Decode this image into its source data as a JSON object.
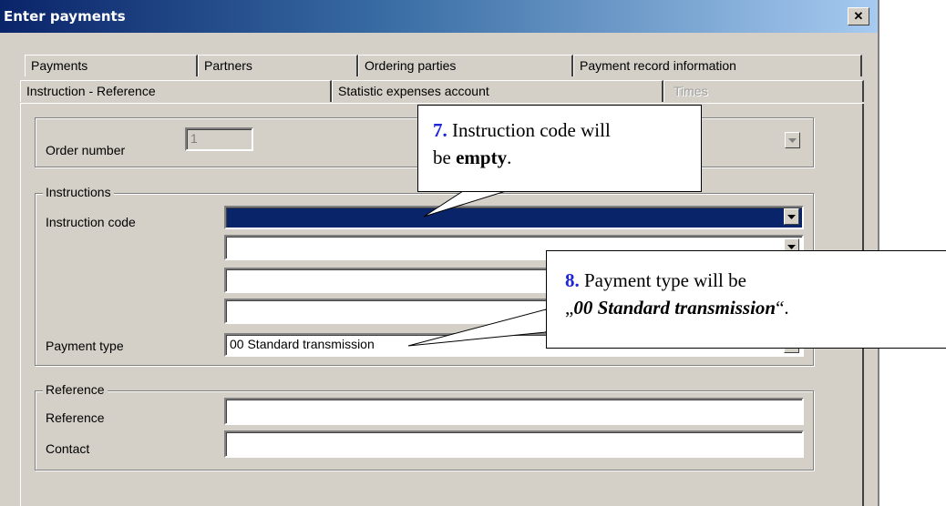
{
  "window": {
    "title": "Enter payments",
    "close_glyph": "✕"
  },
  "tabs_row1": [
    {
      "label": "Payments",
      "disabled": false
    },
    {
      "label": "Partners",
      "disabled": false
    },
    {
      "label": "Ordering parties",
      "disabled": false
    },
    {
      "label": "Payment record information",
      "disabled": false
    }
  ],
  "tabs_row2": [
    {
      "label": "Instruction - Reference",
      "active": true,
      "disabled": false
    },
    {
      "label": "Statistic expenses account",
      "disabled": false
    },
    {
      "label": "Times",
      "disabled": true
    }
  ],
  "order": {
    "label": "Order number",
    "value": "1"
  },
  "instructions": {
    "legend": "Instructions",
    "code_label": "Instruction code",
    "code_value": "",
    "extra_1": "",
    "extra_2": "",
    "extra_3": "",
    "payment_type_label": "Payment type",
    "payment_type_value": "00 Standard transmission"
  },
  "reference": {
    "legend": "Reference",
    "reference_label": "Reference",
    "reference_value": "",
    "contact_label": "Contact",
    "contact_value": ""
  },
  "callouts": {
    "c7": {
      "num": "7.",
      "text1": " Instruction code will",
      "text2a": "be ",
      "text2b": "empty",
      "text2c": "."
    },
    "c8": {
      "num": "8.",
      "text1": " Payment type will be",
      "q_open": "„",
      "value": "00 Standard transmission",
      "q_close": "“."
    }
  },
  "icons": {
    "dropdown": "chevron-down-icon",
    "close": "close-icon"
  },
  "colors": {
    "titlebar_start": "#0a246a",
    "titlebar_end": "#a6caf0",
    "selection": "#0a246a",
    "callout_number": "#1f24d4",
    "face": "#d4d0c8"
  }
}
